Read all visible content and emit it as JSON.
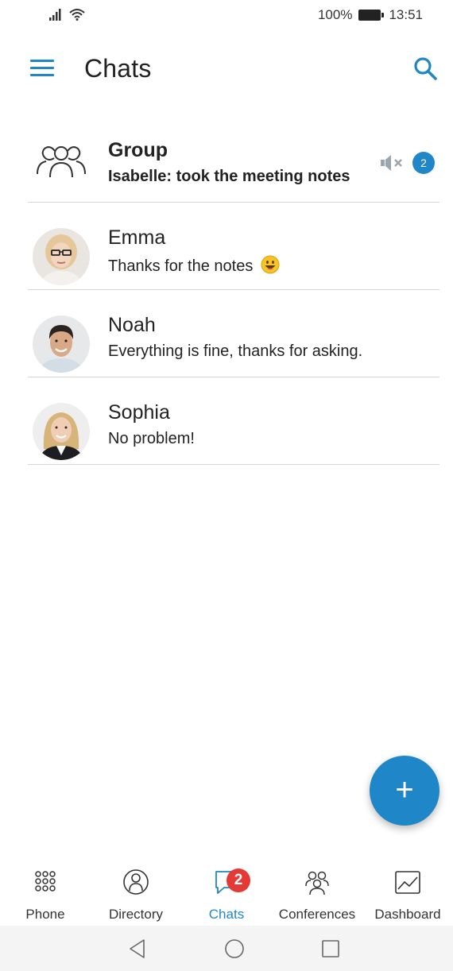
{
  "status_bar": {
    "battery_text": "100%",
    "time": "13:51"
  },
  "header": {
    "title": "Chats"
  },
  "chats": [
    {
      "name": "Group",
      "preview": "Isabelle: took the meeting notes",
      "unread_count": "2",
      "muted": true,
      "avatar": "group-icon"
    },
    {
      "name": "Emma",
      "preview": "Thanks for the notes",
      "avatar": "contact-photo"
    },
    {
      "name": "Noah",
      "preview": "Everything is fine, thanks for asking.",
      "avatar": "contact-photo"
    },
    {
      "name": "Sophia",
      "preview": "No problem!",
      "avatar": "contact-photo"
    }
  ],
  "fab": {
    "label": "+"
  },
  "bottom_nav": {
    "items": [
      {
        "label": "Phone",
        "icon": "dialpad-icon"
      },
      {
        "label": "Directory",
        "icon": "directory-icon"
      },
      {
        "label": "Chats",
        "icon": "chat-bubble-icon",
        "badge": "2",
        "active": true
      },
      {
        "label": "Conferences",
        "icon": "conferences-icon"
      },
      {
        "label": "Dashboard",
        "icon": "dashboard-icon"
      }
    ]
  },
  "colors": {
    "accent": "#1f86c8",
    "badge_red": "#e53935",
    "divider": "#d6d6d6"
  }
}
